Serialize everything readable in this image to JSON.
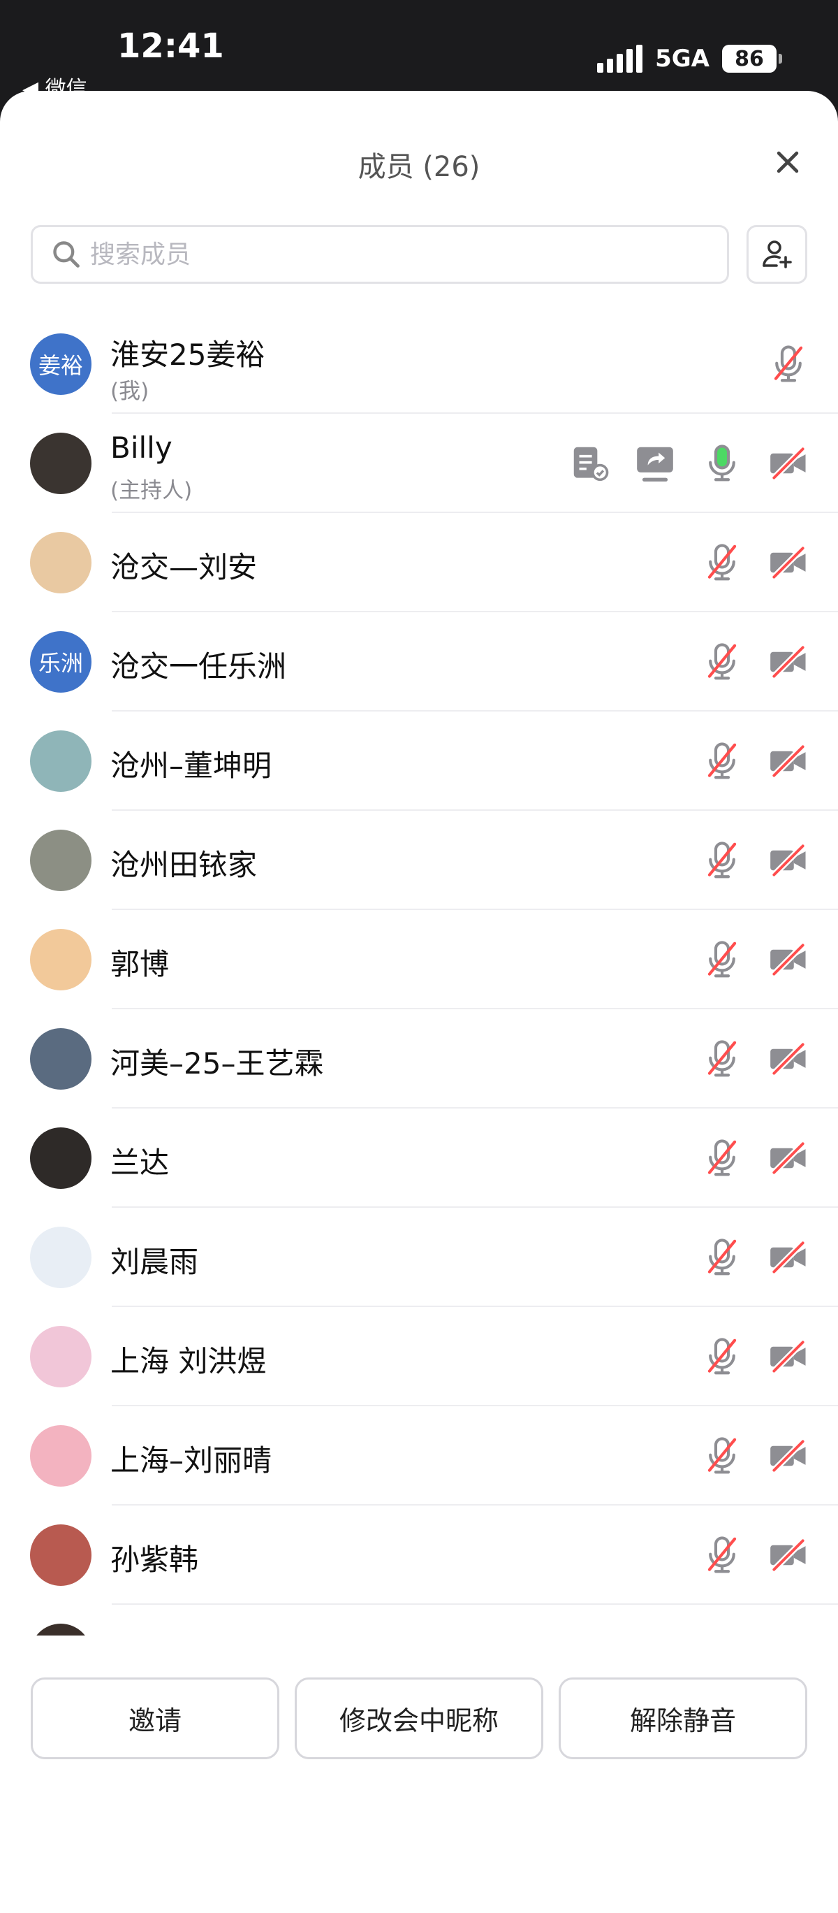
{
  "status_bar": {
    "time": "12:41",
    "back_label": "◀ 微信",
    "network": "5GA",
    "battery": "86"
  },
  "header": {
    "title": "成员 (26)"
  },
  "search": {
    "placeholder": "搜索成员",
    "value": ""
  },
  "members": [
    {
      "name": "淮安25姜裕",
      "subtitle": "(我)",
      "avatar_text": "姜裕",
      "avatar_color": "#3f73c9",
      "mic": "muted",
      "camera": null,
      "extras": []
    },
    {
      "name": "Billy",
      "subtitle": "(主持人)",
      "avatar_text": "",
      "avatar_color": "#3a3430",
      "mic": "active",
      "camera": "off",
      "extras": [
        "document-icon",
        "screen-share-icon"
      ]
    },
    {
      "name": "沧交—刘安",
      "subtitle": "",
      "avatar_text": "",
      "avatar_color": "#e9c9a2",
      "mic": "muted",
      "camera": "off",
      "extras": []
    },
    {
      "name": "沧交一任乐洲",
      "subtitle": "",
      "avatar_text": "乐洲",
      "avatar_color": "#3f73c9",
      "mic": "muted",
      "camera": "off",
      "extras": []
    },
    {
      "name": "沧州–董坤明",
      "subtitle": "",
      "avatar_text": "",
      "avatar_color": "#8fb5b8",
      "mic": "muted",
      "camera": "off",
      "extras": []
    },
    {
      "name": "沧州田铱家",
      "subtitle": "",
      "avatar_text": "",
      "avatar_color": "#8c8f84",
      "mic": "muted",
      "camera": "off",
      "extras": []
    },
    {
      "name": "郭博",
      "subtitle": "",
      "avatar_text": "",
      "avatar_color": "#f2c99a",
      "mic": "muted",
      "camera": "off",
      "extras": []
    },
    {
      "name": "河美–25–王艺霖",
      "subtitle": "",
      "avatar_text": "",
      "avatar_color": "#5a6b80",
      "mic": "muted",
      "camera": "off",
      "extras": []
    },
    {
      "name": "兰达",
      "subtitle": "",
      "avatar_text": "",
      "avatar_color": "#2e2a28",
      "mic": "muted",
      "camera": "off",
      "extras": []
    },
    {
      "name": "刘晨雨",
      "subtitle": "",
      "avatar_text": "",
      "avatar_color": "#e8eef5",
      "mic": "muted",
      "camera": "off",
      "extras": []
    },
    {
      "name": "上海 刘洪煜",
      "subtitle": "",
      "avatar_text": "",
      "avatar_color": "#f1c6d8",
      "mic": "muted",
      "camera": "off",
      "extras": []
    },
    {
      "name": "上海–刘丽晴",
      "subtitle": "",
      "avatar_text": "",
      "avatar_color": "#f3b3c0",
      "mic": "muted",
      "camera": "off",
      "extras": []
    },
    {
      "name": "孙紫韩",
      "subtitle": "",
      "avatar_text": "",
      "avatar_color": "#b85a50",
      "mic": "muted",
      "camera": "off",
      "extras": []
    },
    {
      "name": "",
      "subtitle": "",
      "avatar_text": "",
      "avatar_color": "#3a2f2a",
      "mic": "muted",
      "camera": "off",
      "extras": []
    }
  ],
  "footer": {
    "invite": "邀请",
    "rename": "修改会中昵称",
    "unmute": "解除静音"
  },
  "colors": {
    "muted_slash": "#ff4d4d",
    "active_mic": "#4cd964",
    "icon_gray": "#8e8e93",
    "avatar_blue": "#3f73c9"
  }
}
